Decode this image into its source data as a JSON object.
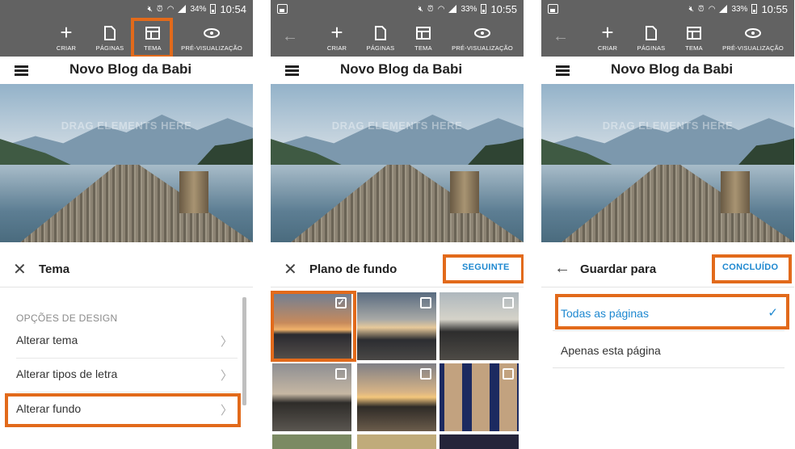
{
  "brand": {
    "accent": "#e26a1b",
    "link": "#1e88d0",
    "chrome": "#626262"
  },
  "blog_title": "Novo Blog da Babi",
  "hero_overlay": "DRAG ELEMENTS HERE",
  "toolbar": {
    "criar": "CRIAR",
    "paginas": "PÁGINAS",
    "tema": "TEMA",
    "preview": "PRÉ-VISUALIZAÇÃO"
  },
  "screens": [
    {
      "status": {
        "battery": "34%",
        "time": "10:54"
      },
      "sheet": {
        "title": "Tema",
        "section": "OPÇÕES DE DESIGN",
        "items": [
          "Alterar tema",
          "Alterar tipos de letra",
          "Alterar fundo"
        ]
      }
    },
    {
      "status": {
        "battery": "33%",
        "time": "10:55"
      },
      "sheet": {
        "title": "Plano de fundo",
        "action": "SEGUINTE",
        "thumbnails": [
          {
            "icon": "sunset-beach-thumbnail",
            "selected": true,
            "check": "✓"
          },
          {
            "icon": "palm-sunset-thumbnail",
            "selected": false
          },
          {
            "icon": "mountain-bay-thumbnail",
            "selected": false
          },
          {
            "icon": "mountain-silhouette-thumbnail",
            "selected": false
          },
          {
            "icon": "palm-beach-thumbnail",
            "selected": false
          },
          {
            "icon": "group-photo-thumbnail",
            "selected": false
          }
        ]
      }
    },
    {
      "status": {
        "battery": "33%",
        "time": "10:55"
      },
      "sheet": {
        "title": "Guardar para",
        "action": "CONCLUÍDO",
        "options": [
          {
            "label": "Todas as páginas",
            "selected": true,
            "check": "✓"
          },
          {
            "label": "Apenas esta página",
            "selected": false
          }
        ]
      }
    }
  ]
}
